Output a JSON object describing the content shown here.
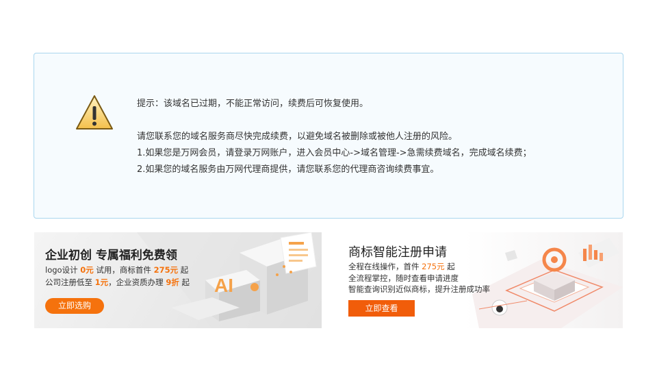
{
  "notice": {
    "tip": "提示：该域名已过期，不能正常访问，续费后可恢复使用。",
    "line1": "请您联系您的域名服务商尽快完成续费，以避免域名被删除或被他人注册的风险。",
    "line2": "1.如果您是万网会员，请登录万网账户，进入会员中心->域名管理->急需续费域名，完成域名续费；",
    "line3": "2.如果您的域名服务由万网代理商提供，请您联系您的代理商咨询续费事宜。"
  },
  "banner_left": {
    "title": "企业初创 专属福利免费领",
    "l1_a": "logo设计 ",
    "l1_b": "0元",
    "l1_c": " 试用，商标首件 ",
    "l1_d": "275元",
    "l1_e": " 起",
    "l2_a": "公司注册低至 ",
    "l2_b": "1元",
    "l2_c": "，企业资质办理 ",
    "l2_d": "9折",
    "l2_e": " 起",
    "button": "立即选购",
    "ai_text": "AI"
  },
  "banner_right": {
    "title": "商标智能注册申请",
    "l1_a": "全程在线操作，首件 ",
    "l1_b": "275元",
    "l1_c": " 起",
    "l2": "全流程掌控，随时查看申请进度",
    "l3": "智能查询识别近似商标，提升注册成功率",
    "button": "立即查看"
  },
  "colors": {
    "accent": "#f5720d",
    "notice_border": "#a9d6ee",
    "notice_bg": "#f6fbfe"
  }
}
